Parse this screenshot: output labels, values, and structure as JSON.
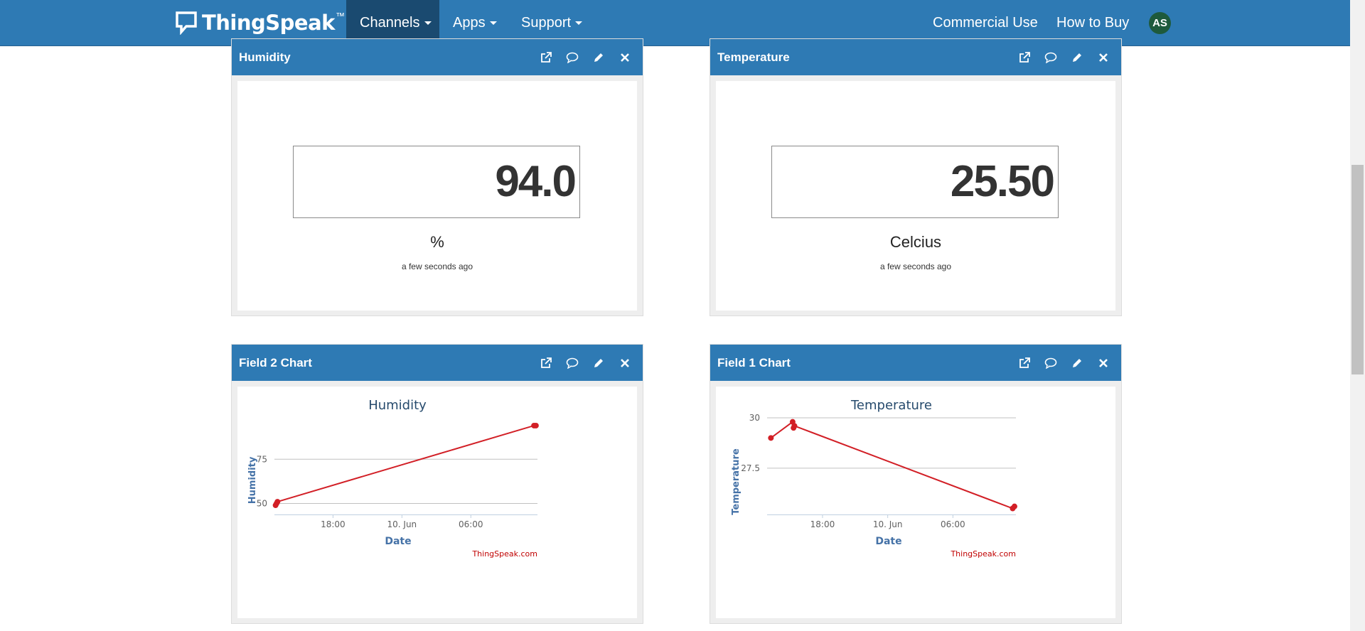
{
  "nav": {
    "brand": "ThingSpeak",
    "brand_tm": "™",
    "channels": "Channels",
    "apps": "Apps",
    "support": "Support",
    "commercial": "Commercial Use",
    "how_to_buy": "How to Buy",
    "avatar": "AS"
  },
  "widgets": {
    "humidity": {
      "title": "Humidity",
      "value": "94.0",
      "unit": "%",
      "time": "a few seconds ago"
    },
    "temperature": {
      "title": "Temperature",
      "value": "25.50",
      "unit": "Celcius",
      "time": "a few seconds ago"
    },
    "field2": {
      "title": "Field 2 Chart"
    },
    "field1": {
      "title": "Field 1 Chart"
    }
  },
  "colors": {
    "header": "#2e7ab4",
    "line": "#d21f26",
    "axis_title": "#4572a7"
  },
  "chart_data": [
    {
      "type": "line",
      "title": "Humidity",
      "xlabel": "Date",
      "ylabel": "Humidity",
      "x_ticks": [
        "18:00",
        "10. Jun",
        "06:00"
      ],
      "y_ticks": [
        50,
        75
      ],
      "credit": "ThingSpeak.com",
      "series": [
        {
          "x": [
            "2018-06-09 13:00",
            "2018-06-09 13:05",
            "2018-06-09 13:10",
            "2018-06-10 11:30",
            "2018-06-10 11:40"
          ],
          "y": [
            49,
            50,
            51,
            94,
            94
          ]
        }
      ]
    },
    {
      "type": "line",
      "title": "Temperature",
      "xlabel": "Date",
      "ylabel": "Temperature",
      "x_ticks": [
        "18:00",
        "10. Jun",
        "06:00"
      ],
      "y_ticks": [
        27.5,
        30
      ],
      "credit": "ThingSpeak.com",
      "series": [
        {
          "x": [
            "2018-06-09 13:15",
            "2018-06-09 15:15",
            "2018-06-09 15:20",
            "2018-06-09 15:25",
            "2018-06-10 11:30",
            "2018-06-10 11:40"
          ],
          "y": [
            29.0,
            29.8,
            29.5,
            29.6,
            25.5,
            25.6
          ]
        }
      ]
    }
  ]
}
